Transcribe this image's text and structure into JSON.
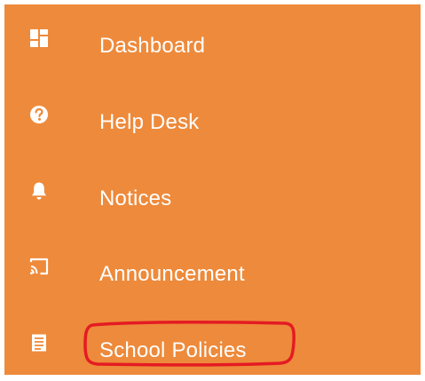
{
  "colors": {
    "sidebar_bg": "#ee8a3b",
    "text": "#ffffff",
    "annotation": "#e41b23"
  },
  "sidebar": {
    "items": [
      {
        "label": "Dashboard",
        "icon": "dashboard-icon"
      },
      {
        "label": "Help Desk",
        "icon": "question-circle-icon"
      },
      {
        "label": "Notices",
        "icon": "bell-icon"
      },
      {
        "label": "Announcement",
        "icon": "cast-icon"
      },
      {
        "label": "School Policies",
        "icon": "document-icon"
      }
    ]
  }
}
